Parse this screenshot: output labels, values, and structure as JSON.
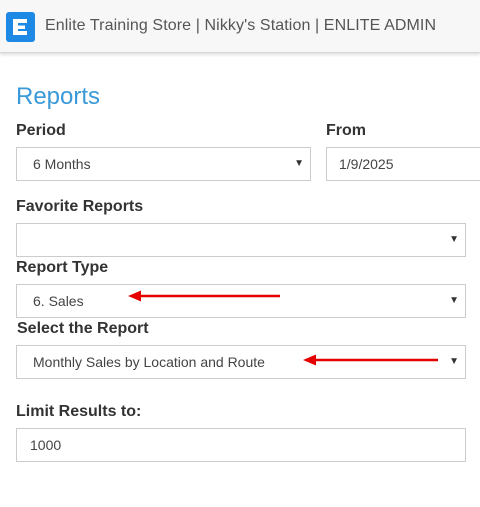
{
  "header": {
    "title": "Enlite Training Store | Nikky's Station | ENLITE ADMIN",
    "logo_icon": "enlite-logo-icon",
    "logo_color": "#1e88e5"
  },
  "page": {
    "title": "Reports"
  },
  "form": {
    "period": {
      "label": "Period",
      "value": "6 Months"
    },
    "from": {
      "label": "From",
      "value": "1/9/2025"
    },
    "favorite_reports": {
      "label": "Favorite Reports",
      "value": ""
    },
    "report_type": {
      "label": "Report Type",
      "value": "6. Sales"
    },
    "select_report": {
      "label": "Select the Report",
      "value": "Monthly Sales by Location and Route"
    },
    "limit_results": {
      "label": "Limit Results to:",
      "value": "1000"
    }
  },
  "colors": {
    "accent": "#3a9ad9",
    "annotation_arrow": "#e60000"
  }
}
